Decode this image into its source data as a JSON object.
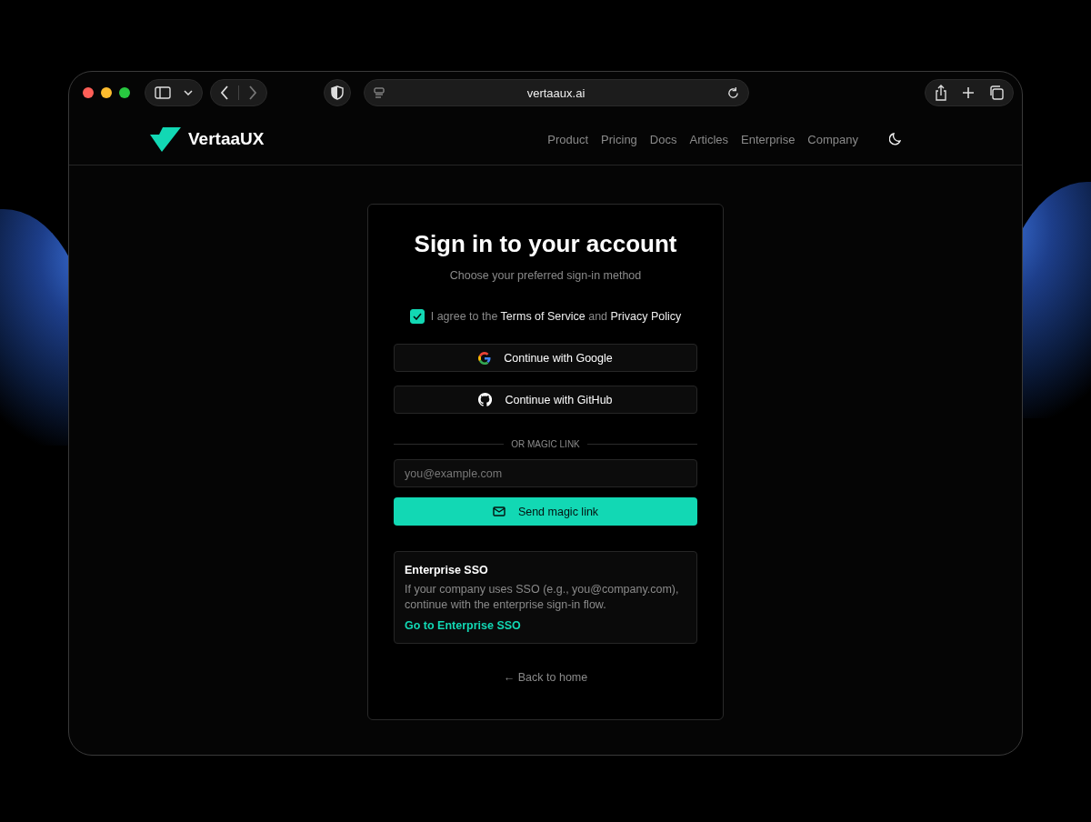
{
  "browser": {
    "url": "vertaaux.ai"
  },
  "site": {
    "logo": "VertaaUX",
    "nav": [
      "Product",
      "Pricing",
      "Docs",
      "Articles",
      "Enterprise",
      "Company"
    ]
  },
  "signin": {
    "title": "Sign in to your account",
    "subtitle": "Choose your preferred sign-in method",
    "agree": {
      "checked": true,
      "prefix": "I agree to the",
      "terms": "Terms of Service",
      "middle": "and",
      "privacy": "Privacy Policy"
    },
    "providers": [
      {
        "kind": "google",
        "label": "Continue with Google"
      },
      {
        "kind": "github",
        "label": "Continue with GitHub"
      }
    ],
    "divider": "OR MAGIC LINK",
    "email": {
      "placeholder": "you@example.com"
    },
    "send_button": "Send magic link",
    "sso": {
      "title": "Enterprise SSO",
      "text": "If your company uses SSO (e.g., you@company.com), continue with the enterprise sign-in flow.",
      "link": "Go to Enterprise SSO"
    },
    "back": "← Back to home"
  }
}
